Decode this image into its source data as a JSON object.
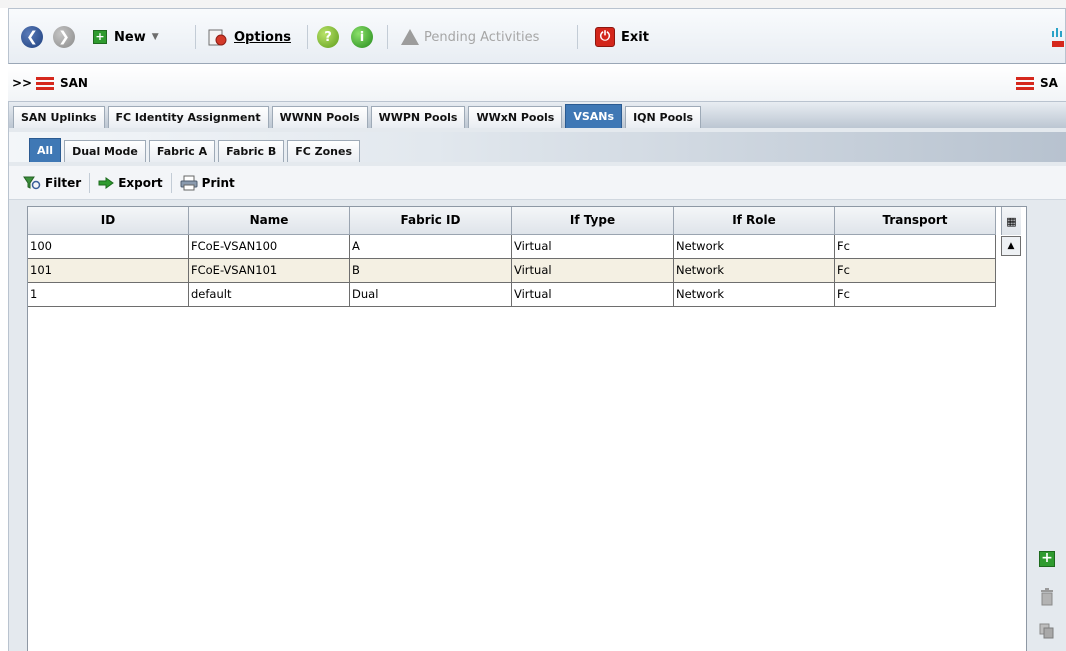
{
  "toolbar": {
    "new_label": "New",
    "options_label": "Options",
    "pending_label": "Pending Activities",
    "exit_label": "Exit"
  },
  "path": {
    "prefix": ">>",
    "current": "SAN",
    "right_label": "SA"
  },
  "main_tabs": [
    {
      "label": "SAN Uplinks"
    },
    {
      "label": "FC Identity Assignment"
    },
    {
      "label": "WWNN Pools"
    },
    {
      "label": "WWPN Pools"
    },
    {
      "label": "WWxN Pools"
    },
    {
      "label": "VSANs",
      "active": true
    },
    {
      "label": "IQN Pools"
    }
  ],
  "sub_tabs": [
    {
      "label": "All",
      "active": true
    },
    {
      "label": "Dual Mode"
    },
    {
      "label": "Fabric A"
    },
    {
      "label": "Fabric B"
    },
    {
      "label": "FC Zones"
    }
  ],
  "actions": {
    "filter": "Filter",
    "export": "Export",
    "print": "Print"
  },
  "table": {
    "columns": [
      "ID",
      "Name",
      "Fabric ID",
      "If Type",
      "If Role",
      "Transport"
    ],
    "rows": [
      [
        "100",
        "FCoE-VSAN100",
        "A",
        "Virtual",
        "Network",
        "Fc"
      ],
      [
        "101",
        "FCoE-VSAN101",
        "B",
        "Virtual",
        "Network",
        "Fc"
      ],
      [
        "1",
        "default",
        "Dual",
        "Virtual",
        "Network",
        "Fc"
      ]
    ]
  },
  "colors": {
    "active_tab": "#3f78b5",
    "selected_row": "#f4f0e3",
    "exit_red": "#d3261b",
    "add_green": "#2f9b2f"
  },
  "icons": {
    "back": "back-arrow-icon",
    "forward": "forward-arrow-icon",
    "new": "plus-square-icon",
    "options": "options-icon",
    "help": "help-icon",
    "info": "info-icon",
    "pending": "warning-icon",
    "exit": "exit-icon",
    "filter": "filter-icon",
    "export": "export-arrow-icon",
    "print": "printer-icon",
    "add": "add-icon",
    "delete": "trash-icon",
    "copy": "copy-icon"
  }
}
